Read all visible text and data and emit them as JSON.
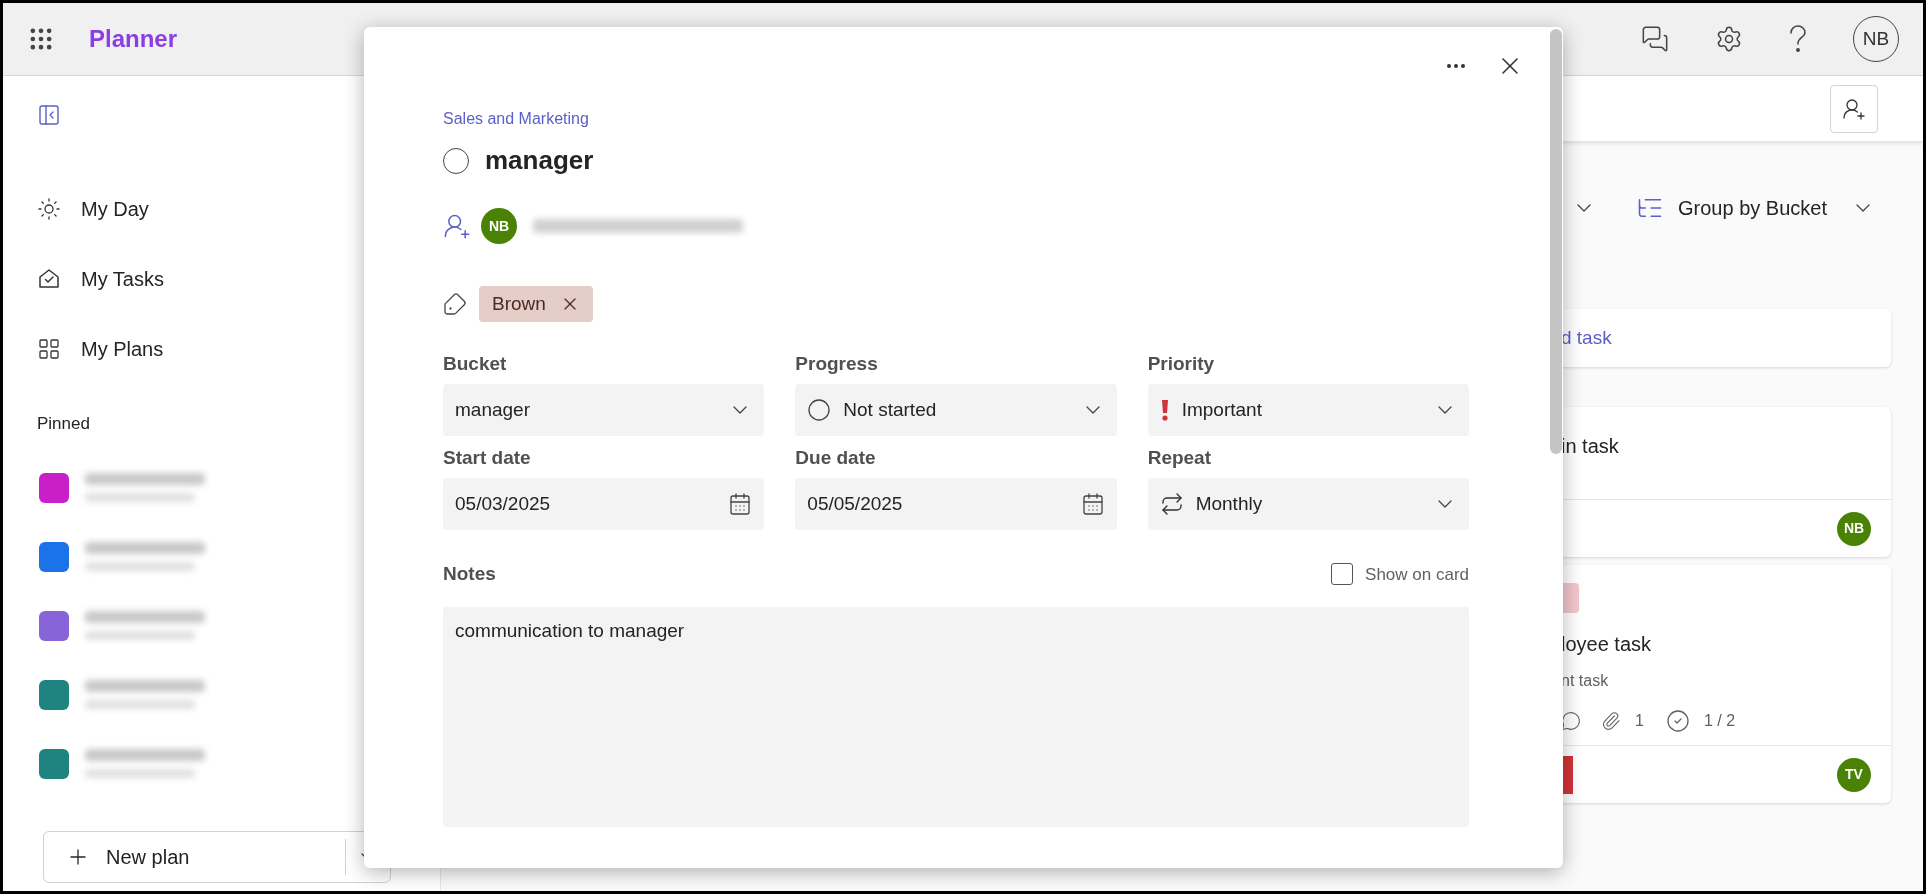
{
  "app_bar": {
    "app_name": "Planner",
    "avatar_initials": "NB"
  },
  "sidebar": {
    "nav": [
      {
        "kind": "day",
        "label": "My Day",
        "selected": false
      },
      {
        "kind": "tasks",
        "label": "My Tasks",
        "selected": false
      },
      {
        "kind": "plans",
        "label": "My Plans",
        "selected": false
      }
    ],
    "pinned_heading": "Pinned",
    "pinned_plans": [
      {
        "color": "#c81fc8"
      },
      {
        "color": "#1a73e8"
      },
      {
        "color": "#8764d8"
      },
      {
        "color": "#1f8480"
      },
      {
        "color": "#1f8480"
      }
    ],
    "new_plan_button": "New plan"
  },
  "board": {
    "group_by": "Group by Bucket",
    "add_task": "d task",
    "cards": [
      {
        "title": "in task",
        "assignee": "NB"
      },
      {
        "top_tag": {
          "color": "#f3c6ce"
        },
        "title": "loyee task",
        "note": "nt task",
        "attachments": "1",
        "checklist": "1 / 2",
        "bottom_tag": {
          "color": "#d13438"
        },
        "assignee": "TV"
      }
    ]
  },
  "task_dialog": {
    "plan": "Sales and Marketing",
    "title": "manager",
    "completed": false,
    "assignee_initials": "NB",
    "labels": [
      {
        "text": "Brown",
        "color": "#e5cec8"
      }
    ],
    "fields": [
      {
        "kind": "plain",
        "label": "Bucket",
        "value": "manager"
      },
      {
        "kind": "progress",
        "label": "Progress",
        "value": "Not started"
      },
      {
        "kind": "priority",
        "label": "Priority",
        "value": "Important"
      },
      {
        "kind": "date",
        "label": "Start date",
        "value": "05/03/2025"
      },
      {
        "kind": "date",
        "label": "Due date",
        "value": "05/05/2025"
      },
      {
        "kind": "repeat",
        "label": "Repeat",
        "value": "Monthly"
      }
    ],
    "notes_label": "Notes",
    "show_on_card": {
      "label": "Show on card",
      "checked": false
    },
    "notes": "communication to manager"
  }
}
